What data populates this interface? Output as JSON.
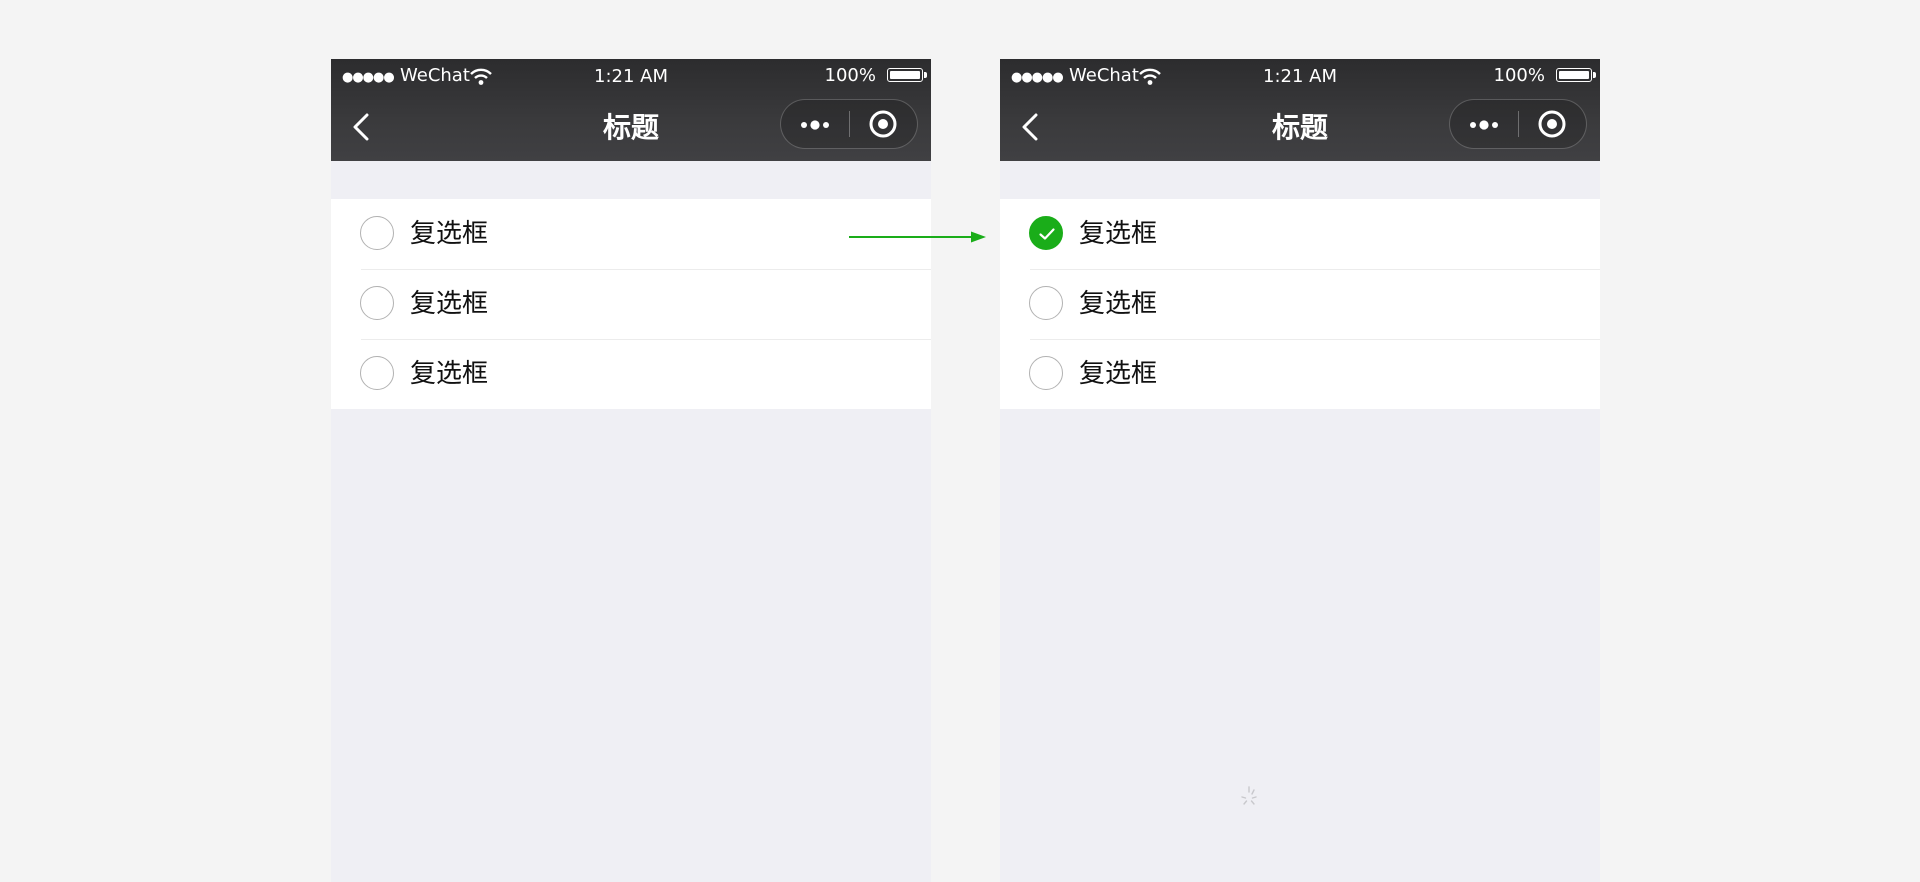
{
  "colors": {
    "accent": "#1aad19",
    "topbar": "#333336",
    "page_bg": "#efeff4"
  },
  "screens": [
    {
      "status": {
        "signal": "●●●●●",
        "carrier": "WeChat",
        "time": "1:21 AM",
        "battery": "100%"
      },
      "nav": {
        "title": "标题",
        "back_icon": "chevron-left-icon",
        "more_icon": "more-icon",
        "close_icon": "target-icon"
      },
      "items": [
        {
          "label": "复选框",
          "checked": false
        },
        {
          "label": "复选框",
          "checked": false
        },
        {
          "label": "复选框",
          "checked": false
        }
      ]
    },
    {
      "status": {
        "signal": "●●●●●",
        "carrier": "WeChat",
        "time": "1:21 AM",
        "battery": "100%"
      },
      "nav": {
        "title": "标题",
        "back_icon": "chevron-left-icon",
        "more_icon": "more-icon",
        "close_icon": "target-icon"
      },
      "items": [
        {
          "label": "复选框",
          "checked": true
        },
        {
          "label": "复选框",
          "checked": false
        },
        {
          "label": "复选框",
          "checked": false
        }
      ]
    }
  ]
}
